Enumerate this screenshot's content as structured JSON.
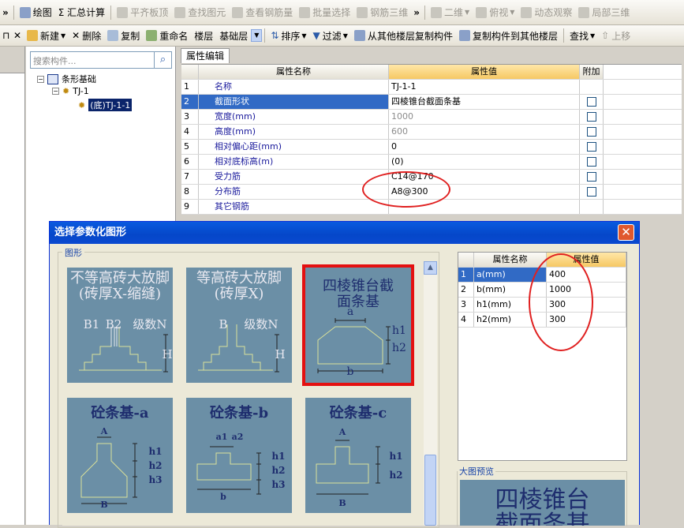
{
  "toolbar1": {
    "items": [
      {
        "label": "绘图",
        "icon": "draw-icon",
        "enabled": true
      },
      {
        "label": "Σ 汇总计算",
        "icon": "sum-icon",
        "enabled": true
      },
      {
        "label": "平齐板顶",
        "icon": "align-top-icon",
        "enabled": false
      },
      {
        "label": "查找图元",
        "icon": "find-element-icon",
        "enabled": false
      },
      {
        "label": "查看钢筋量",
        "icon": "view-rebar-icon",
        "enabled": false
      },
      {
        "label": "批量选择",
        "icon": "batch-select-icon",
        "enabled": false
      },
      {
        "label": "钢筋三维",
        "icon": "rebar-3d-icon",
        "enabled": false
      },
      {
        "label": "二维",
        "icon": "2d-icon",
        "enabled": false
      },
      {
        "label": "俯视",
        "icon": "top-view-icon",
        "enabled": false
      },
      {
        "label": "动态观察",
        "icon": "orbit-icon",
        "enabled": false
      },
      {
        "label": "局部三维",
        "icon": "local-3d-icon",
        "enabled": false
      }
    ]
  },
  "toolbar2": {
    "new": "新建",
    "delete": "删除",
    "copy": "复制",
    "rename": "重命名",
    "floor_label": "楼层",
    "floor_value": "基础层",
    "sort": "排序",
    "filter": "过滤",
    "copy_from": "从其他楼层复制构件",
    "copy_to": "复制构件到其他楼层",
    "find": "查找",
    "up": "上移"
  },
  "tree": {
    "search_placeholder": "搜索构件...",
    "root": "条形基础",
    "child": "TJ-1",
    "leaf": "(底)TJ-1-1"
  },
  "props": {
    "tab": "属性编辑",
    "headers": [
      "属性名称",
      "属性值",
      "附加"
    ],
    "rows": [
      {
        "n": "1",
        "name": "名称",
        "value": "TJ-1-1",
        "grey": false,
        "cb": false
      },
      {
        "n": "2",
        "name": "截面形状",
        "value": "四棱锥台截面条基",
        "grey": false,
        "cb": true
      },
      {
        "n": "3",
        "name": "宽度(mm)",
        "value": "1000",
        "grey": true,
        "cb": true
      },
      {
        "n": "4",
        "name": "高度(mm)",
        "value": "600",
        "grey": true,
        "cb": true
      },
      {
        "n": "5",
        "name": "相对偏心距(mm)",
        "value": "0",
        "grey": false,
        "cb": true
      },
      {
        "n": "6",
        "name": "相对底标高(m)",
        "value": "(0)",
        "grey": false,
        "cb": true
      },
      {
        "n": "7",
        "name": "受力筋",
        "value": "C14@170",
        "grey": false,
        "cb": true
      },
      {
        "n": "8",
        "name": "分布筋",
        "value": "A8@300",
        "grey": false,
        "cb": true
      },
      {
        "n": "9",
        "name": "其它钢筋",
        "value": "",
        "grey": false,
        "cb": false
      }
    ]
  },
  "dialog": {
    "title": "选择参数化图形",
    "group_label": "图形",
    "preview_label": "大图预览",
    "preview_title": "四棱锥台截面条基",
    "shapes": [
      {
        "title": "不等高砖大放脚(砖厚X-缩缝)",
        "labels": [
          "B1",
          "B2",
          "级数N",
          "H"
        ]
      },
      {
        "title": "等高砖大放脚(砖厚X)",
        "labels": [
          "B",
          "级数N",
          "H"
        ]
      },
      {
        "title": "四棱锥台截面条基",
        "labels": [
          "a",
          "h1",
          "h2",
          "b"
        ],
        "selected": true
      },
      {
        "title": "砼条基-a",
        "labels": [
          "A",
          "h1",
          "h2",
          "h3",
          "B"
        ]
      },
      {
        "title": "砼条基-b",
        "labels": [
          "a1",
          "a2",
          "h1",
          "h2",
          "h3",
          "b"
        ]
      },
      {
        "title": "砼条基-c",
        "labels": [
          "A",
          "h1",
          "h2",
          "B"
        ]
      }
    ],
    "param_headers": [
      "属性名称",
      "属性值"
    ],
    "params": [
      {
        "n": "1",
        "name": "a(mm)",
        "value": "400"
      },
      {
        "n": "2",
        "name": "b(mm)",
        "value": "1000"
      },
      {
        "n": "3",
        "name": "h1(mm)",
        "value": "300"
      },
      {
        "n": "4",
        "name": "h2(mm)",
        "value": "300"
      }
    ]
  },
  "colors": {
    "accent": "#316ac5",
    "highlight": "#e41010",
    "shape_bg": "#6b8fa6"
  }
}
